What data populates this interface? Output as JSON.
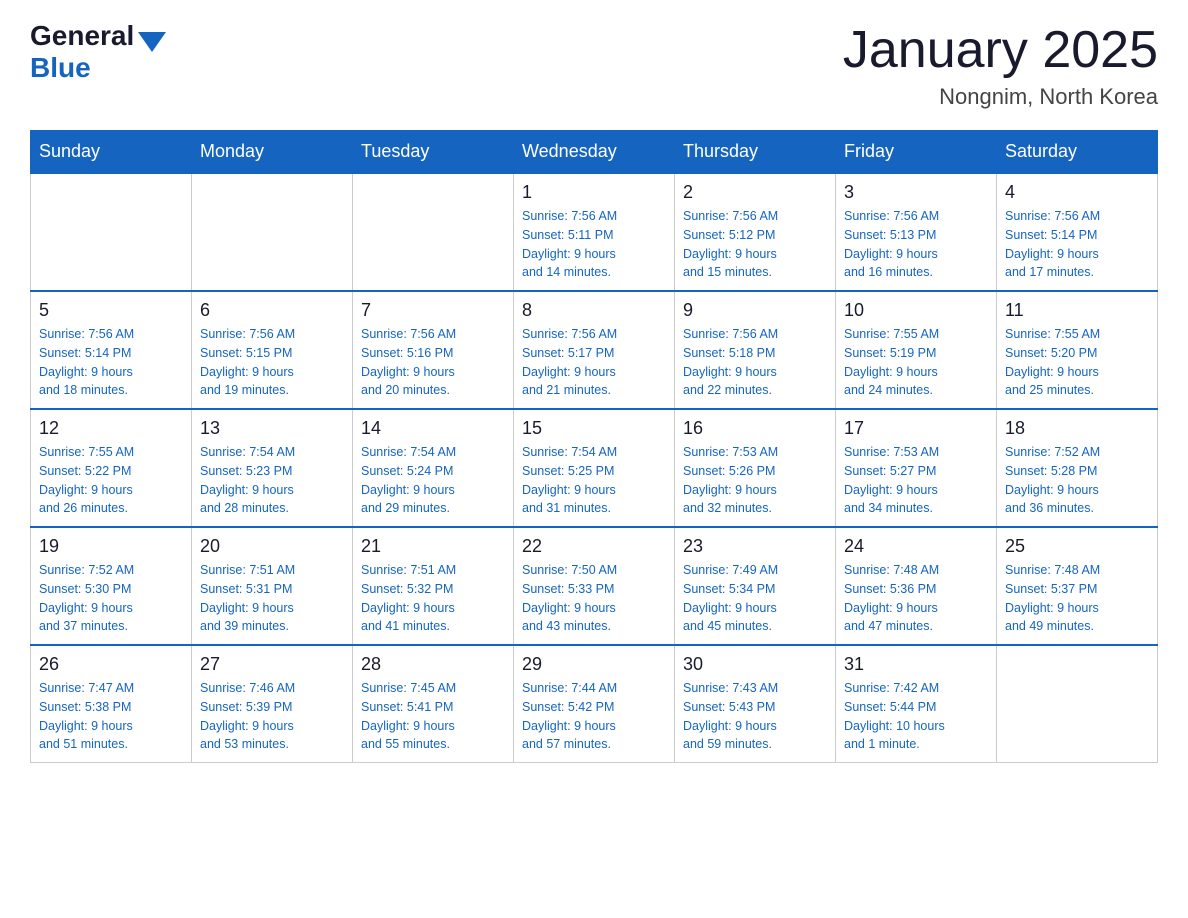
{
  "header": {
    "logo": {
      "text1": "General",
      "text2": "Blue"
    },
    "title": "January 2025",
    "location": "Nongnim, North Korea"
  },
  "days_of_week": [
    "Sunday",
    "Monday",
    "Tuesday",
    "Wednesday",
    "Thursday",
    "Friday",
    "Saturday"
  ],
  "weeks": [
    [
      {
        "day": "",
        "info": ""
      },
      {
        "day": "",
        "info": ""
      },
      {
        "day": "",
        "info": ""
      },
      {
        "day": "1",
        "info": "Sunrise: 7:56 AM\nSunset: 5:11 PM\nDaylight: 9 hours\nand 14 minutes."
      },
      {
        "day": "2",
        "info": "Sunrise: 7:56 AM\nSunset: 5:12 PM\nDaylight: 9 hours\nand 15 minutes."
      },
      {
        "day": "3",
        "info": "Sunrise: 7:56 AM\nSunset: 5:13 PM\nDaylight: 9 hours\nand 16 minutes."
      },
      {
        "day": "4",
        "info": "Sunrise: 7:56 AM\nSunset: 5:14 PM\nDaylight: 9 hours\nand 17 minutes."
      }
    ],
    [
      {
        "day": "5",
        "info": "Sunrise: 7:56 AM\nSunset: 5:14 PM\nDaylight: 9 hours\nand 18 minutes."
      },
      {
        "day": "6",
        "info": "Sunrise: 7:56 AM\nSunset: 5:15 PM\nDaylight: 9 hours\nand 19 minutes."
      },
      {
        "day": "7",
        "info": "Sunrise: 7:56 AM\nSunset: 5:16 PM\nDaylight: 9 hours\nand 20 minutes."
      },
      {
        "day": "8",
        "info": "Sunrise: 7:56 AM\nSunset: 5:17 PM\nDaylight: 9 hours\nand 21 minutes."
      },
      {
        "day": "9",
        "info": "Sunrise: 7:56 AM\nSunset: 5:18 PM\nDaylight: 9 hours\nand 22 minutes."
      },
      {
        "day": "10",
        "info": "Sunrise: 7:55 AM\nSunset: 5:19 PM\nDaylight: 9 hours\nand 24 minutes."
      },
      {
        "day": "11",
        "info": "Sunrise: 7:55 AM\nSunset: 5:20 PM\nDaylight: 9 hours\nand 25 minutes."
      }
    ],
    [
      {
        "day": "12",
        "info": "Sunrise: 7:55 AM\nSunset: 5:22 PM\nDaylight: 9 hours\nand 26 minutes."
      },
      {
        "day": "13",
        "info": "Sunrise: 7:54 AM\nSunset: 5:23 PM\nDaylight: 9 hours\nand 28 minutes."
      },
      {
        "day": "14",
        "info": "Sunrise: 7:54 AM\nSunset: 5:24 PM\nDaylight: 9 hours\nand 29 minutes."
      },
      {
        "day": "15",
        "info": "Sunrise: 7:54 AM\nSunset: 5:25 PM\nDaylight: 9 hours\nand 31 minutes."
      },
      {
        "day": "16",
        "info": "Sunrise: 7:53 AM\nSunset: 5:26 PM\nDaylight: 9 hours\nand 32 minutes."
      },
      {
        "day": "17",
        "info": "Sunrise: 7:53 AM\nSunset: 5:27 PM\nDaylight: 9 hours\nand 34 minutes."
      },
      {
        "day": "18",
        "info": "Sunrise: 7:52 AM\nSunset: 5:28 PM\nDaylight: 9 hours\nand 36 minutes."
      }
    ],
    [
      {
        "day": "19",
        "info": "Sunrise: 7:52 AM\nSunset: 5:30 PM\nDaylight: 9 hours\nand 37 minutes."
      },
      {
        "day": "20",
        "info": "Sunrise: 7:51 AM\nSunset: 5:31 PM\nDaylight: 9 hours\nand 39 minutes."
      },
      {
        "day": "21",
        "info": "Sunrise: 7:51 AM\nSunset: 5:32 PM\nDaylight: 9 hours\nand 41 minutes."
      },
      {
        "day": "22",
        "info": "Sunrise: 7:50 AM\nSunset: 5:33 PM\nDaylight: 9 hours\nand 43 minutes."
      },
      {
        "day": "23",
        "info": "Sunrise: 7:49 AM\nSunset: 5:34 PM\nDaylight: 9 hours\nand 45 minutes."
      },
      {
        "day": "24",
        "info": "Sunrise: 7:48 AM\nSunset: 5:36 PM\nDaylight: 9 hours\nand 47 minutes."
      },
      {
        "day": "25",
        "info": "Sunrise: 7:48 AM\nSunset: 5:37 PM\nDaylight: 9 hours\nand 49 minutes."
      }
    ],
    [
      {
        "day": "26",
        "info": "Sunrise: 7:47 AM\nSunset: 5:38 PM\nDaylight: 9 hours\nand 51 minutes."
      },
      {
        "day": "27",
        "info": "Sunrise: 7:46 AM\nSunset: 5:39 PM\nDaylight: 9 hours\nand 53 minutes."
      },
      {
        "day": "28",
        "info": "Sunrise: 7:45 AM\nSunset: 5:41 PM\nDaylight: 9 hours\nand 55 minutes."
      },
      {
        "day": "29",
        "info": "Sunrise: 7:44 AM\nSunset: 5:42 PM\nDaylight: 9 hours\nand 57 minutes."
      },
      {
        "day": "30",
        "info": "Sunrise: 7:43 AM\nSunset: 5:43 PM\nDaylight: 9 hours\nand 59 minutes."
      },
      {
        "day": "31",
        "info": "Sunrise: 7:42 AM\nSunset: 5:44 PM\nDaylight: 10 hours\nand 1 minute."
      },
      {
        "day": "",
        "info": ""
      }
    ]
  ]
}
